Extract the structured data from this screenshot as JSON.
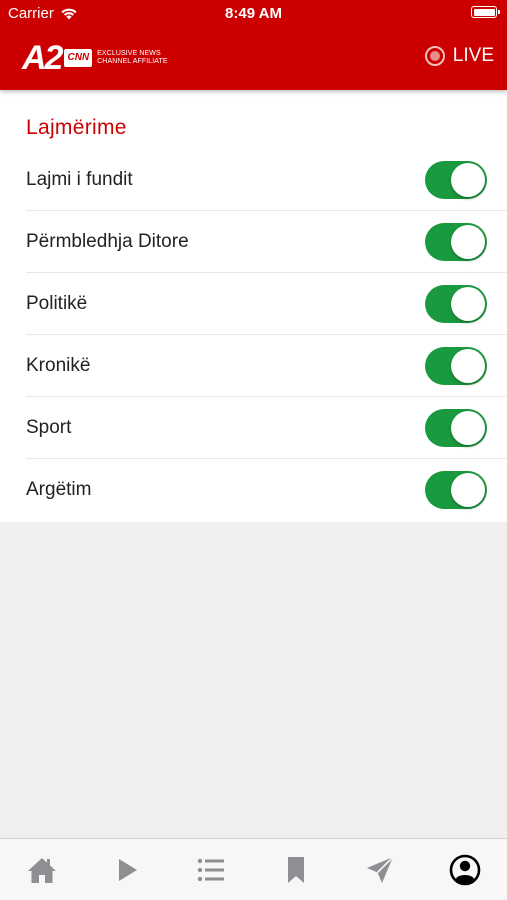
{
  "status_bar": {
    "carrier": "Carrier",
    "time": "8:49 AM",
    "battery_level": 1.0
  },
  "header": {
    "logo_text": "A2",
    "logo_badge": "CNN",
    "logo_tagline": "EXCLUSIVE NEWS CHANNEL AFFILIATE",
    "live_label": "LIVE"
  },
  "settings": {
    "section_title": "Lajmërime",
    "items": [
      {
        "label": "Lajmi i fundit",
        "enabled": true
      },
      {
        "label": "Përmbledhja Ditore",
        "enabled": true
      },
      {
        "label": "Politikë",
        "enabled": true
      },
      {
        "label": "Kronikë",
        "enabled": true
      },
      {
        "label": "Sport",
        "enabled": true
      },
      {
        "label": "Argëtim",
        "enabled": true
      }
    ]
  },
  "tab_bar": {
    "tabs": [
      {
        "icon": "home-icon",
        "active": false
      },
      {
        "icon": "play-icon",
        "active": false
      },
      {
        "icon": "list-icon",
        "active": false
      },
      {
        "icon": "bookmark-icon",
        "active": false
      },
      {
        "icon": "send-icon",
        "active": false
      },
      {
        "icon": "profile-icon",
        "active": true
      }
    ]
  },
  "colors": {
    "brand_red": "#cc0000",
    "toggle_on": "#1a9a3e",
    "tab_inactive": "#8e8e93",
    "tab_active": "#000000"
  }
}
